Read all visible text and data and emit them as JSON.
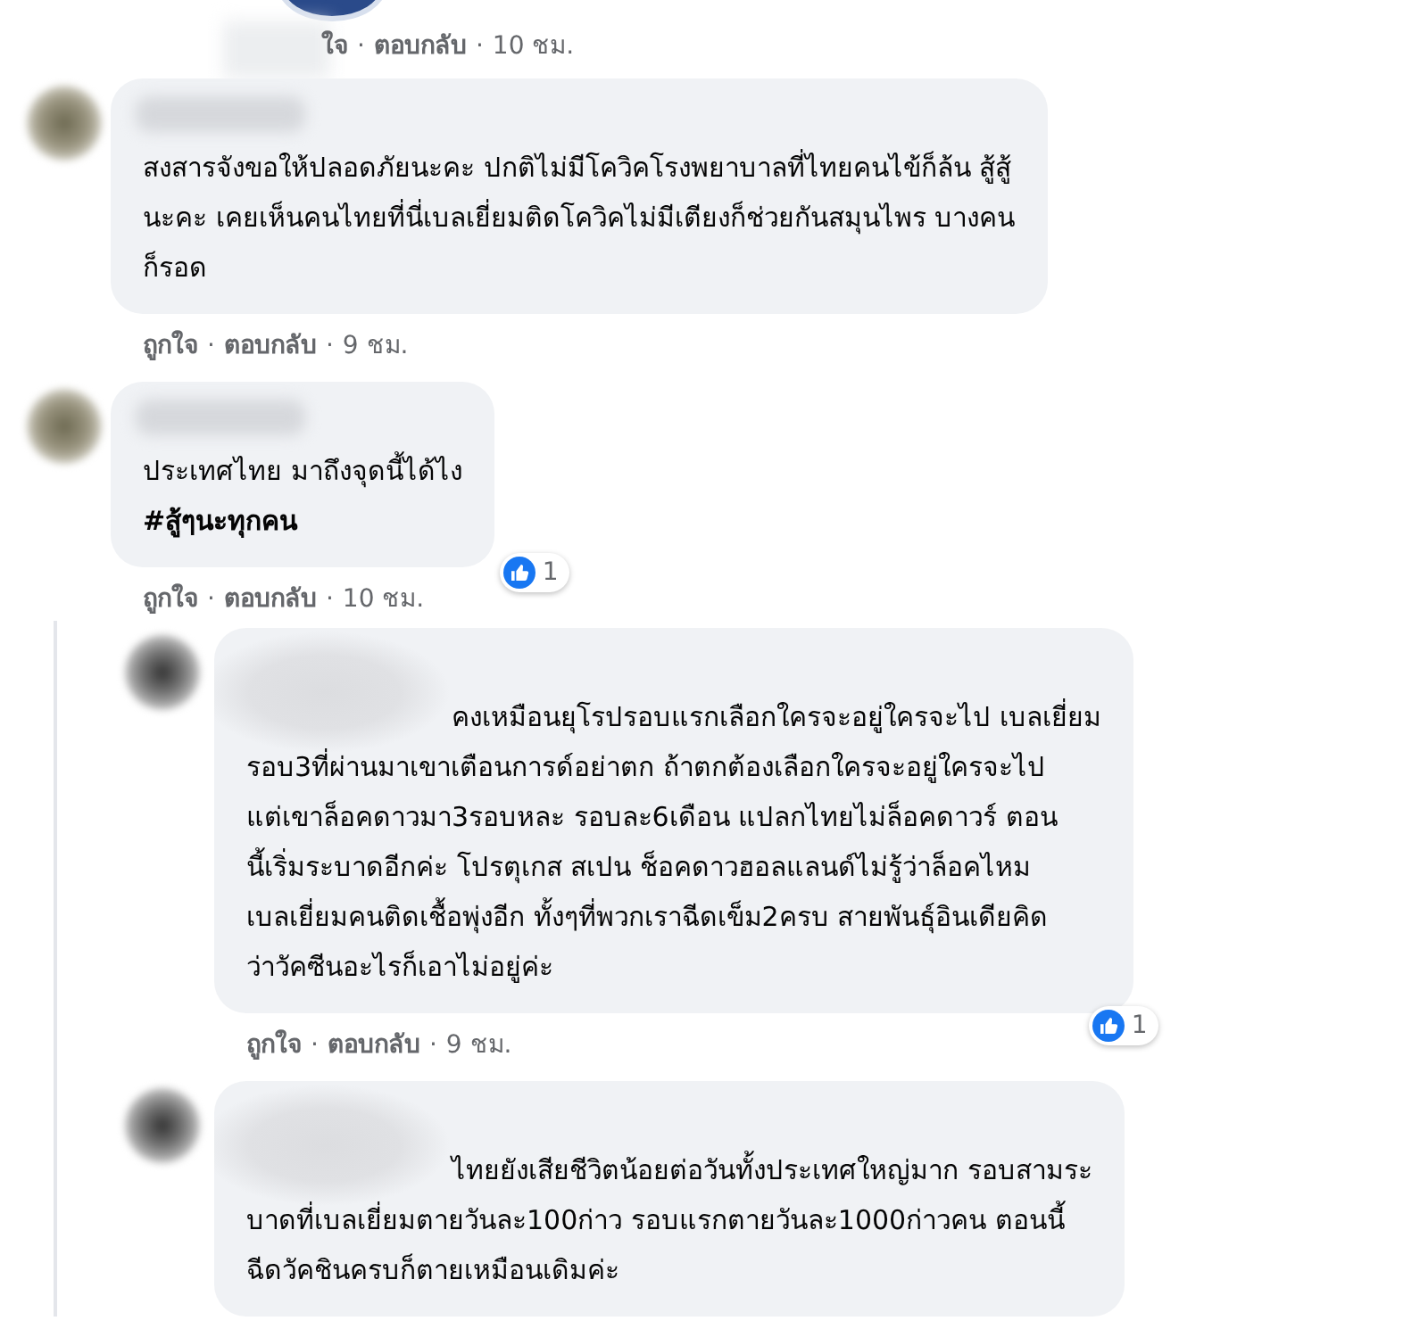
{
  "top_meta": {
    "like": "ใจ",
    "sep": "·",
    "reply": "ตอบกลับ",
    "time": "10 ชม."
  },
  "comments": [
    {
      "text": "สงสารจังขอให้ปลอดภัยนะคะ ปกติไม่มีโควิคโรงพยาบาลที่ไทยคนไข้ก็ล้น สู้สู้\nนะคะ เคยเห็นคนไทยที่นี่เบลเยี่ยมติดโควิคไม่มีเตียงก็ช่วยกันสมุนไพร บางคน\nก็รอด",
      "meta": {
        "like": "ถูกใจ",
        "sep": "·",
        "reply": "ตอบกลับ",
        "time": "9 ชม."
      }
    },
    {
      "text": "ประเทศไทย มาถึงจุดนี้ได้ไง\n**#สู้ๆนะทุกคน**",
      "reaction": {
        "count": "1"
      },
      "meta": {
        "like": "ถูกใจ",
        "sep": "·",
        "reply": "ตอบกลับ",
        "time": "10 ชม."
      },
      "children": [
        {
          "text": "คงเหมือนยุโรปรอบแรกเลือกใครจะอยู่ใครจะไป เบลเยี่ยม\nรอบ3ที่ผ่านมาเขาเตือนการด์อย่าตก ถ้าตกต้องเลือกใครจะอยู่ใครจะไป\nแต่เขาล็อคดาวมา3รอบหละ รอบละ6เดือน แปลกไทยไม่ล็อคดาวร์ ตอน\nนี้เริ่มระบาดอีกค่ะ โปรตุเกส สเปน ช็อคดาวฮอลแลนด์ไม่รู้ว่าล็อคไหม\nเบลเยี่ยมคนติดเชื้อพุ่งอีก ทั้งๆที่พวกเราฉีดเข็ม2ครบ สายพันธุ์อินเดียคิด\nว่าวัคซีนอะไรก็เอาไม่อยู่ค่ะ",
          "reaction": {
            "count": "1"
          },
          "meta": {
            "like": "ถูกใจ",
            "sep": "·",
            "reply": "ตอบกลับ",
            "time": "9 ชม."
          }
        },
        {
          "text": "ไทยยังเสียชีวิตน้อยต่อวันทั้งประเทศใหญ่มาก รอบสามระ\nบาดที่เบลเยี่ยมตายวันละ100ก่าว รอบแรกตายวันละ1000ก่าวคน ตอนนี้\nฉีดวัคชินครบก็ตายเหมือนเดิมค่ะ"
        }
      ]
    }
  ]
}
